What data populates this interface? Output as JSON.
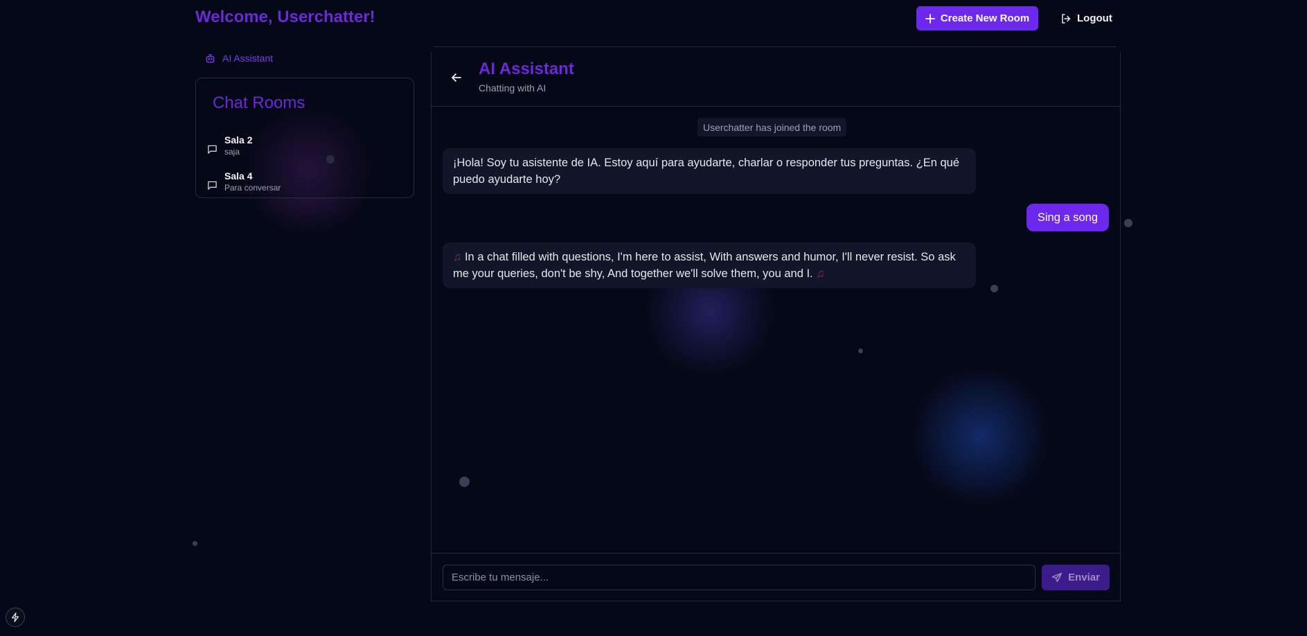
{
  "header": {
    "welcome": "Welcome, Userchatter!",
    "create_room_label": "Create New Room",
    "logout_label": "Logout"
  },
  "sidebar": {
    "ai_link_label": "AI Assistant",
    "rooms_title": "Chat Rooms",
    "rooms": [
      {
        "name": "Sala 2",
        "description": "saja"
      },
      {
        "name": "Sala 4",
        "description": "Para conversar"
      }
    ]
  },
  "chat": {
    "title": "AI Assistant",
    "subtitle": "Chatting with AI",
    "system_message": "Userchatter has joined the room",
    "messages": [
      {
        "sender": "ai",
        "text": "¡Hola! Soy tu asistente de IA. Estoy aquí para ayudarte, charlar o responder tus preguntas. ¿En qué puedo ayudarte hoy?"
      },
      {
        "sender": "user",
        "text": "Sing a song"
      },
      {
        "sender": "ai",
        "text": "In a chat filled with questions, I'm here to assist, With answers and humor, I'll never resist. So ask me your queries, don't be shy, And together we'll solve them, you and I."
      }
    ],
    "input_placeholder": "Escribe tu mensaje...",
    "send_label": "Enviar"
  },
  "colors": {
    "background": "#050816",
    "accent": "#6d28ee",
    "title_purple": "#6d28d9"
  },
  "icons": [
    "plus-icon",
    "logout-icon",
    "bot-icon",
    "message-square-icon",
    "arrow-left-icon",
    "music-note-icon",
    "send-icon",
    "bolt-icon"
  ]
}
